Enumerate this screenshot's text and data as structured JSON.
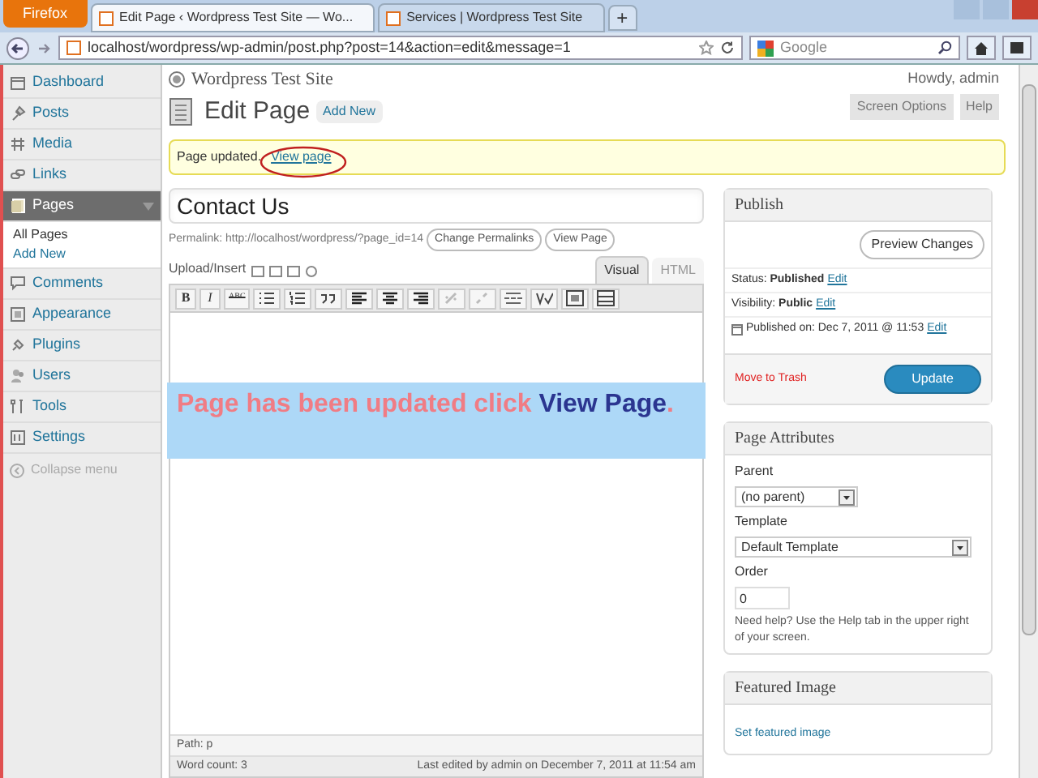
{
  "browser": {
    "menu_button": "Firefox",
    "tabs": [
      {
        "title": "Edit Page ‹ Wordpress Test Site — Wo...",
        "selected": true
      },
      {
        "title": "Services | Wordpress Test Site",
        "selected": false
      }
    ],
    "new_tab": "+",
    "url": "localhost/wordpress/wp-admin/post.php?post=14&action=edit&message=1",
    "search": {
      "placeholder": "Google"
    }
  },
  "sidebar": {
    "items": [
      {
        "label": "Dashboard",
        "selected": false
      },
      {
        "label": "Posts",
        "selected": false
      },
      {
        "label": "Media",
        "selected": false
      },
      {
        "label": "Links",
        "selected": false
      },
      {
        "label": "Pages",
        "selected": true,
        "children": [
          {
            "label": "All Pages",
            "selected": true
          },
          {
            "label": "Add New",
            "selected": false
          }
        ]
      },
      {
        "label": "Comments",
        "selected": false
      },
      {
        "label": "Appearance",
        "selected": false
      },
      {
        "label": "Plugins",
        "selected": false
      },
      {
        "label": "Users",
        "selected": false
      },
      {
        "label": "Tools",
        "selected": false
      },
      {
        "label": "Settings",
        "selected": false
      }
    ],
    "collapse": "Collapse menu"
  },
  "header": {
    "site_title": "Wordpress Test Site",
    "greeting": "Howdy, admin",
    "screen_options": "Screen Options",
    "help": "Help"
  },
  "page": {
    "title": "Edit Page",
    "add_new": "Add New"
  },
  "notice": {
    "text": "Page updated.",
    "link": "View page"
  },
  "editor": {
    "title_value": "Contact Us",
    "permalink": "Permalink: http://localhost/wordpress/?page_id=14",
    "permalink_buttons": [
      "Change Permalinks",
      "View Page"
    ],
    "upload_label": "Upload/Insert",
    "tabs": [
      {
        "label": "Visual",
        "selected": true
      },
      {
        "label": "HTML",
        "selected": false
      }
    ],
    "toolbar": [
      {
        "kind": "text",
        "label": "B"
      },
      {
        "kind": "italic",
        "label": "I"
      },
      {
        "kind": "small",
        "label": "ABC"
      },
      {
        "kind": "bullets"
      },
      {
        "kind": "numbers"
      },
      {
        "kind": "quote"
      },
      {
        "kind": "alignleft"
      },
      {
        "kind": "aligncenter"
      },
      {
        "kind": "alignright"
      },
      {
        "kind": "link"
      },
      {
        "kind": "unlink"
      },
      {
        "kind": "more"
      },
      {
        "kind": "spell"
      },
      {
        "kind": "fullscreen"
      },
      {
        "kind": "sink"
      }
    ],
    "path": "Path: p",
    "word_count": "Word count: 3",
    "last_edited": "Last edited by admin on December 7, 2011 at 11:54 am"
  },
  "annotation": {
    "text": "Page has been updated click ",
    "link": "View Page",
    "end": "."
  },
  "publish": {
    "title": "Publish",
    "preview": "Preview Changes",
    "rows": [
      {
        "label": "Status: ",
        "value": "Published",
        "edit": "Edit"
      },
      {
        "label": "Visibility: ",
        "value": "Public",
        "edit": "Edit"
      },
      {
        "label": "Published on: ",
        "value": "Dec 7, 2011 @ 11:53",
        "edit": "Edit"
      }
    ],
    "trash": "Move to Trash",
    "update": "Update"
  },
  "page_attributes": {
    "title": "Page Attributes",
    "parent_label": "Parent",
    "parent_value": "(no parent)",
    "template_label": "Template",
    "template_value": "Default Template",
    "order_label": "Order",
    "order_value": "0",
    "help": "Need help? Use the Help tab in the upper right of your screen."
  },
  "featured_image": {
    "title": "Featured Image",
    "link": "Set featured image"
  }
}
